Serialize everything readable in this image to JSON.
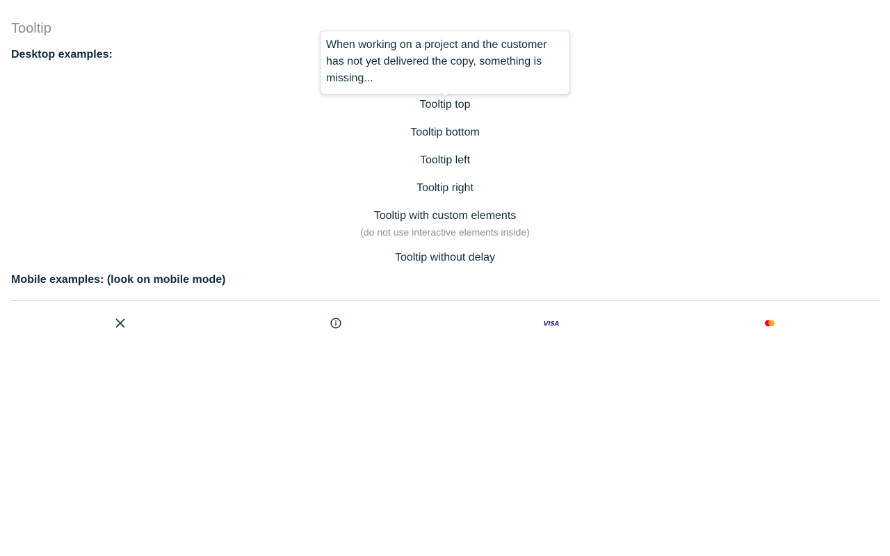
{
  "page": {
    "title": "Tooltip",
    "desktop_label": "Desktop examples:",
    "mobile_label": "Mobile examples: (look on mobile mode)"
  },
  "tooltip": {
    "text": "When working on a project and the customer has not yet delivered the copy, something is missing..."
  },
  "triggers": {
    "top": "Tooltip top",
    "bottom": "Tooltip bottom",
    "left": "Tooltip left",
    "right": "Tooltip right",
    "custom": "Tooltip with custom elements",
    "custom_note": "(do not use interactive elements inside)",
    "no_delay": "Tooltip without delay"
  },
  "mobile_icons": {
    "items": [
      {
        "icon": "close-icon"
      },
      {
        "icon": "info-icon"
      },
      {
        "icon": "visa-icon",
        "text": "VISA"
      },
      {
        "icon": "mastercard-icon"
      }
    ]
  },
  "colors": {
    "text": "#0f2a3d",
    "muted": "#8a8f94",
    "divider": "#d8dde1",
    "visa": "#1a1f71",
    "mc_red": "#eb001b",
    "mc_orange": "#f79e1b"
  }
}
